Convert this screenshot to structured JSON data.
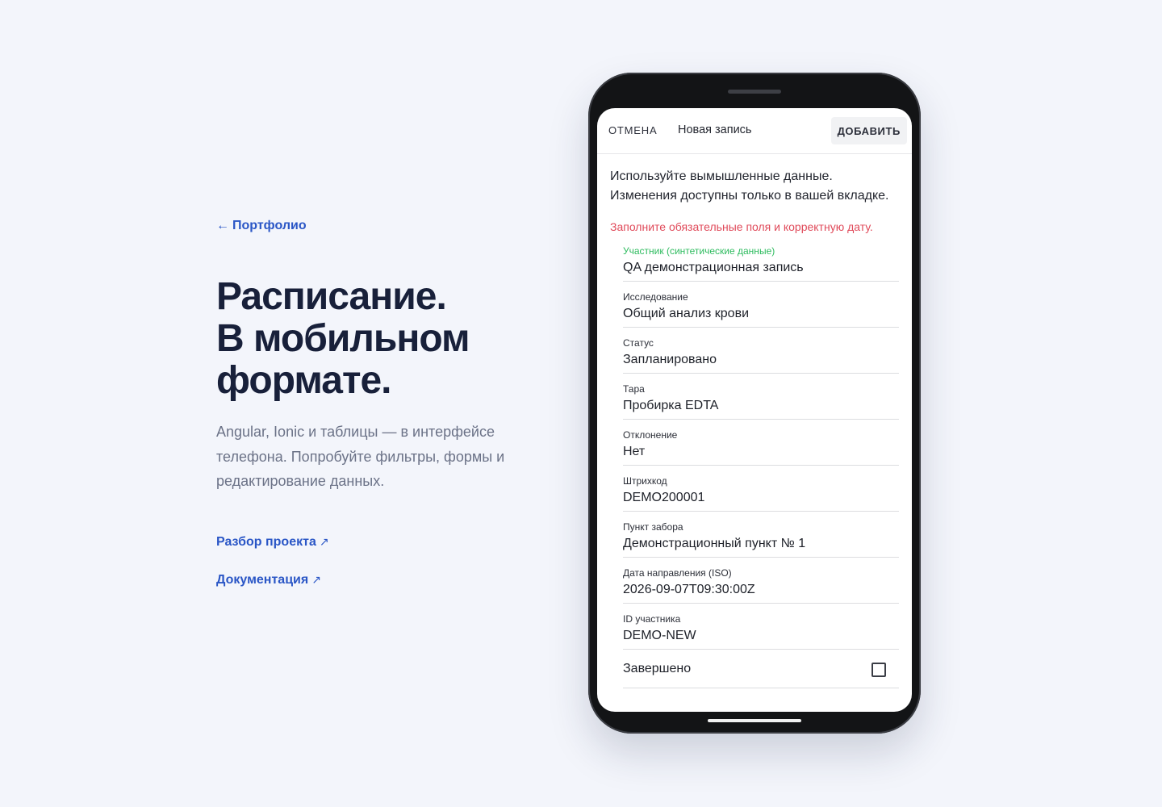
{
  "intro": {
    "back_arrow": "←",
    "back_label": "Портфолио",
    "headline": [
      "Расписание.",
      "В мобильном",
      "формате."
    ],
    "lead": "Angular, Ionic и таблицы — в интерфейсе телефона. Попробуйте фильтры, формы и редактирование данных.",
    "links": [
      {
        "label": "Разбор проекта",
        "icon": "↗"
      },
      {
        "label": "Документация",
        "icon": "↗"
      }
    ]
  },
  "toolbar": {
    "cancel_label": "ОТМЕНА",
    "title": "Новая запись",
    "add_label": "ДОБАВИТЬ"
  },
  "notice": {
    "line1": "Используйте вымышленные данные.",
    "line2": "Изменения доступны только в вашей вкладке."
  },
  "error": "Заполните обязательные поля и корректную дату.",
  "fields": [
    {
      "label": "Участник (синтетические данные)",
      "value": "QA демонстрационная запись"
    },
    {
      "label": "Исследование",
      "value": "Общий анализ крови"
    },
    {
      "label": "Статус",
      "value": "Запланировано"
    },
    {
      "label": "Тара",
      "value": "Пробирка EDTA"
    },
    {
      "label": "Отклонение",
      "value": "Нет"
    },
    {
      "label": "Штрихкод",
      "value": "DEMO200001"
    },
    {
      "label": "Пункт забора",
      "value": "Демонстрационный пункт № 1"
    },
    {
      "label": "Дата направления (ISO)",
      "value": "2026-09-07T09:30:00Z"
    },
    {
      "label": "ID участника",
      "value": "DEMO-NEW"
    }
  ],
  "completed": {
    "label": "Завершено",
    "checked": false
  },
  "colors": {
    "accent_link": "#2a56c6",
    "active_label": "#2dbb5e",
    "error": "#e04a5a",
    "background": "#f3f5fb"
  }
}
